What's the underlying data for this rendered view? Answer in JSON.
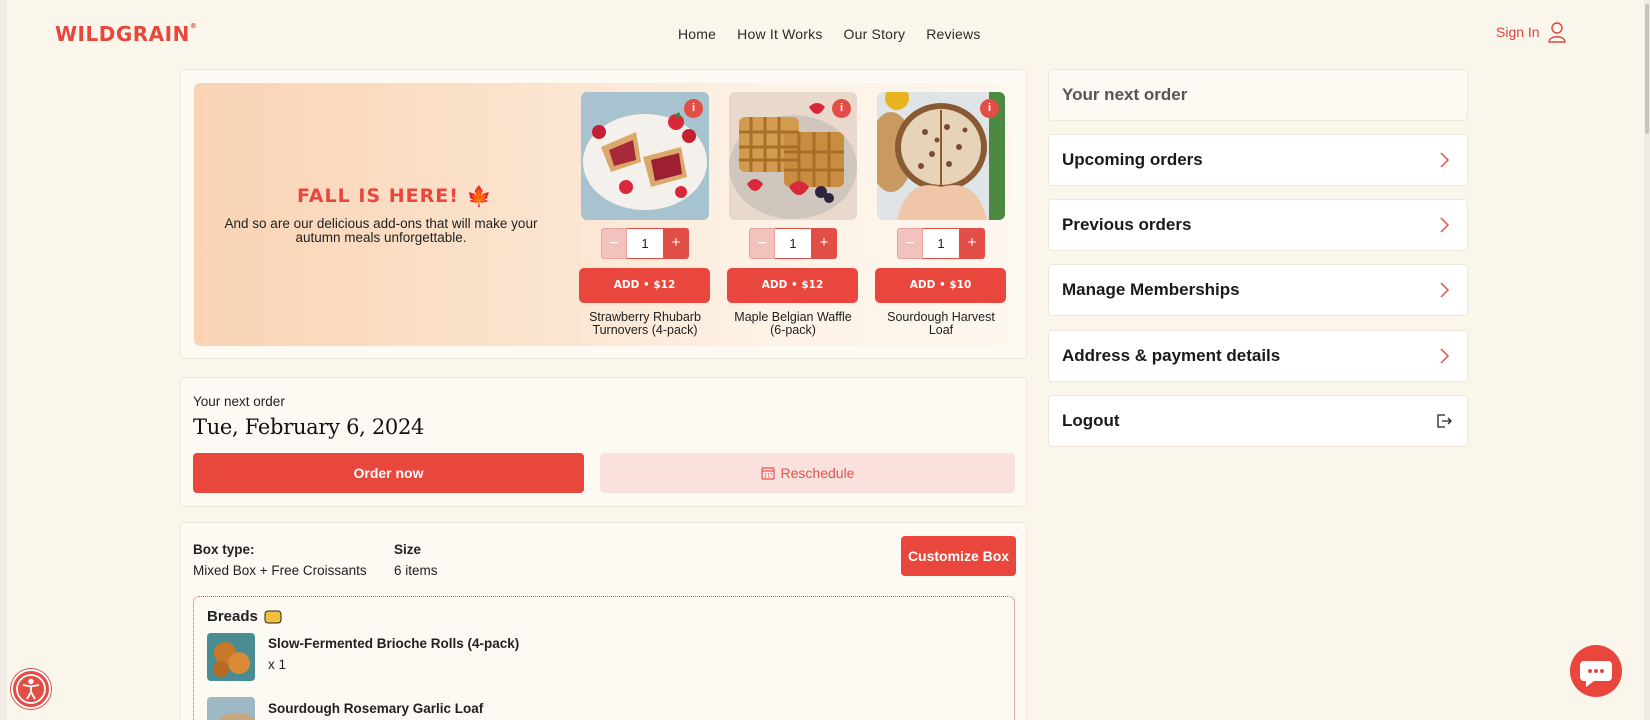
{
  "header": {
    "logo": "WILDGRAIN",
    "logo_mark": "®",
    "nav": [
      "Home",
      "How It Works",
      "Our Story",
      "Reviews"
    ],
    "sign_in": "Sign In"
  },
  "promo": {
    "title": "FALL IS HERE!",
    "subtitle": "And so are our delicious add-ons that will make your autumn meals unforgettable.",
    "products": [
      {
        "name": "Strawberry Rhubarb Turnovers (4-pack)",
        "qty": "1",
        "add_label": "ADD • $12",
        "minus": "−",
        "plus": "+"
      },
      {
        "name": "Maple Belgian Waffle (6-pack)",
        "qty": "1",
        "add_label": "ADD • $12",
        "minus": "−",
        "plus": "+"
      },
      {
        "name": "Sourdough Harvest Loaf",
        "qty": "1",
        "add_label": "ADD • $10",
        "minus": "−",
        "plus": "+"
      }
    ]
  },
  "next_order": {
    "label": "Your next order",
    "date": "Tue, February 6, 2024",
    "order_now": "Order now",
    "reschedule": "Reschedule"
  },
  "box": {
    "type_label": "Box type:",
    "type_value": "Mixed Box + Free Croissants",
    "size_label": "Size",
    "size_value": "6 items",
    "customize": "Customize Box",
    "section_title": "Breads",
    "items": [
      {
        "name": "Slow-Fermented Brioche Rolls (4-pack)",
        "qty": "x 1"
      },
      {
        "name": "Sourdough Rosemary Garlic Loaf"
      }
    ]
  },
  "sidebar": {
    "items": [
      {
        "label": "Your next order"
      },
      {
        "label": "Upcoming orders"
      },
      {
        "label": "Previous orders"
      },
      {
        "label": "Manage Memberships"
      },
      {
        "label": "Address & payment details"
      },
      {
        "label": "Logout"
      }
    ]
  },
  "colors": {
    "accent": "#e9463d",
    "background": "#fbf6ec"
  }
}
